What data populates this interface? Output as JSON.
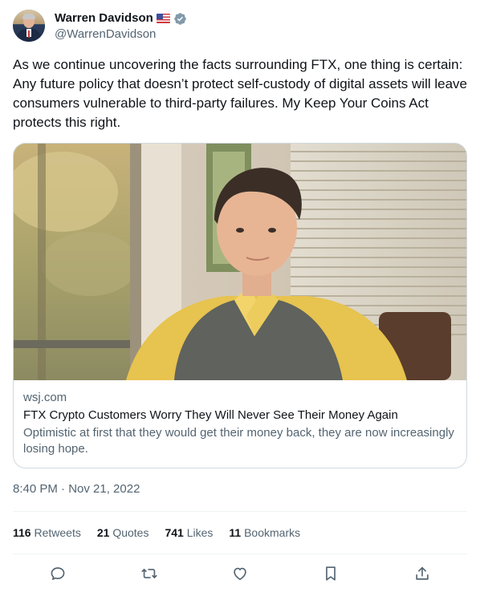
{
  "author": {
    "name": "Warren Davidson",
    "handle": "@WarrenDavidson",
    "flag": "us-flag-icon",
    "verified_icon": "verified-badge-icon"
  },
  "tweet": {
    "text": "As we continue uncovering the facts surrounding FTX, one thing is certain: Any future policy that doesn’t protect self-custody of digital assets will leave consumers vulnerable to third-party failures. My Keep Your Coins Act protects this right."
  },
  "card": {
    "domain": "wsj.com",
    "title": "FTX Crypto Customers Worry They Will Never See Their Money Again",
    "description": "Optimistic at first that they would get their money back, they are now increasingly losing hope."
  },
  "timestamp": "8:40 PM · Nov 21, 2022",
  "stats": {
    "retweets": {
      "count": "116",
      "label": "Retweets"
    },
    "quotes": {
      "count": "21",
      "label": "Quotes"
    },
    "likes": {
      "count": "741",
      "label": "Likes"
    },
    "bookmarks": {
      "count": "11",
      "label": "Bookmarks"
    }
  },
  "actions": [
    "reply-icon",
    "retweet-icon",
    "like-icon",
    "bookmark-icon",
    "share-icon"
  ],
  "colors": {
    "text": "#0f1419",
    "secondary": "#536471",
    "border": "#cfd9de",
    "verified": "#829aab"
  }
}
